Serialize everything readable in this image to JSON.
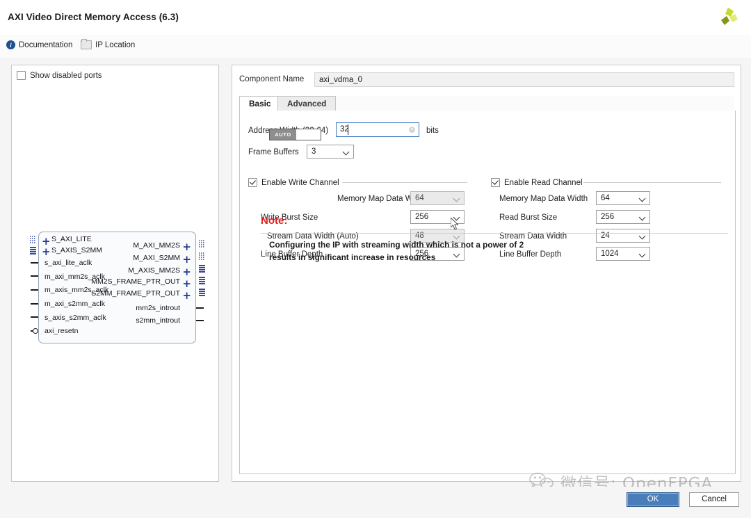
{
  "window": {
    "title": "AXI Video Direct Memory Access (6.3)",
    "logo_icon": "vivado-pinwheel-icon"
  },
  "toolbar": {
    "documentation": "Documentation",
    "ip_location": "IP Location",
    "doc_icon": "info-icon",
    "iploc_icon": "folder-icon"
  },
  "ports_panel": {
    "show_disabled_ports": "Show disabled ports",
    "show_disabled_checked": false,
    "block": {
      "left_ports": [
        {
          "name": "S_AXI_LITE",
          "type": "bus"
        },
        {
          "name": "S_AXIS_S2MM",
          "type": "bus"
        },
        {
          "name": "s_axi_lite_aclk",
          "type": "pin"
        },
        {
          "name": "m_axi_mm2s_aclk",
          "type": "pin"
        },
        {
          "name": "m_axis_mm2s_aclk",
          "type": "pin"
        },
        {
          "name": "m_axi_s2mm_aclk",
          "type": "pin"
        },
        {
          "name": "s_axis_s2mm_aclk",
          "type": "pin"
        },
        {
          "name": "axi_resetn",
          "type": "pin-inverted"
        }
      ],
      "right_ports": [
        {
          "name": "M_AXI_MM2S",
          "type": "bus"
        },
        {
          "name": "M_AXI_S2MM",
          "type": "bus"
        },
        {
          "name": "M_AXIS_MM2S",
          "type": "bus"
        },
        {
          "name": "MM2S_FRAME_PTR_OUT",
          "type": "bus"
        },
        {
          "name": "S2MM_FRAME_PTR_OUT",
          "type": "bus"
        },
        {
          "name": "mm2s_introut",
          "type": "pin"
        },
        {
          "name": "s2mm_introut",
          "type": "pin"
        }
      ]
    }
  },
  "config": {
    "component_name_label": "Component Name",
    "component_name_value": "axi_vdma_0",
    "tabs": [
      {
        "label": "Basic",
        "active": true
      },
      {
        "label": "Advanced",
        "active": false
      }
    ],
    "address_width": {
      "label": "Address Width (32-64)",
      "value": "32",
      "units": "bits",
      "clear_icon": "clear-circle-icon"
    },
    "frame_buffers": {
      "label": "Frame Buffers",
      "value": "3"
    },
    "write_channel": {
      "group_label": "Enable Write Channel",
      "enabled": true,
      "auto_toggle_label": "AUTO",
      "rows": [
        {
          "label": "Memory Map Data Width",
          "value": "64",
          "disabled": true
        },
        {
          "label": "Write Burst Size",
          "value": "256",
          "disabled": false
        },
        {
          "label": "Stream Data Width (Auto)",
          "value": "48",
          "disabled": true
        },
        {
          "label": "Line Buffer Depth",
          "value": "256",
          "disabled": false
        }
      ]
    },
    "read_channel": {
      "group_label": "Enable Read Channel",
      "enabled": true,
      "rows": [
        {
          "label": "Memory Map Data Width",
          "value": "64",
          "disabled": false
        },
        {
          "label": "Read Burst Size",
          "value": "256",
          "disabled": false
        },
        {
          "label": "Stream Data Width",
          "value": "24",
          "disabled": false
        },
        {
          "label": "Line Buffer Depth",
          "value": "1024",
          "disabled": false
        }
      ]
    },
    "note": {
      "title": "Note:",
      "line1": "Configuring the IP with streaming width which is not a power of 2",
      "line2": "results in significant increase in resources"
    }
  },
  "footer": {
    "ok": "OK",
    "cancel": "Cancel"
  },
  "watermark": {
    "text": "微信号: OpenFPGA",
    "icon": "wechat-icon"
  },
  "colors": {
    "accent_blue": "#4a7ebb",
    "note_red": "#e02020",
    "bus_blue": "#24368e",
    "logo_green": "#b5cc28"
  }
}
